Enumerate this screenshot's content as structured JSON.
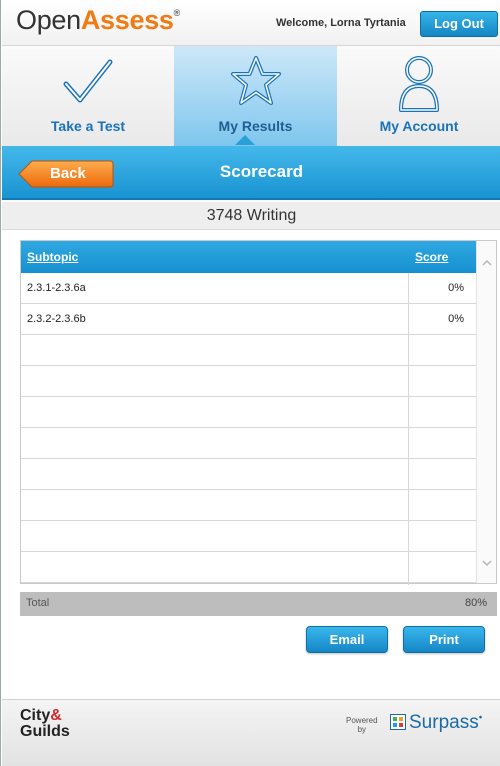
{
  "header": {
    "logo_open": "Open",
    "logo_assess": "Assess",
    "logo_reg": "®",
    "welcome": "Welcome, Lorna Tyrtania",
    "logout_label": "Log Out"
  },
  "nav": {
    "tabs": [
      {
        "label": "Take a Test",
        "icon": "checkmark-icon",
        "active": false
      },
      {
        "label": "My Results",
        "icon": "star-icon",
        "active": true
      },
      {
        "label": "My Account",
        "icon": "person-icon",
        "active": false
      }
    ]
  },
  "titlebar": {
    "back_label": "Back",
    "title": "Scorecard"
  },
  "subtitle": "3748 Writing",
  "table": {
    "headers": [
      "Subtopic",
      "Score"
    ],
    "rows": [
      {
        "subtopic": "2.3.1-2.3.6a",
        "score": "0%"
      },
      {
        "subtopic": "2.3.2-2.3.6b",
        "score": "0%"
      },
      {
        "subtopic": "",
        "score": ""
      },
      {
        "subtopic": "",
        "score": ""
      },
      {
        "subtopic": "",
        "score": ""
      },
      {
        "subtopic": "",
        "score": ""
      },
      {
        "subtopic": "",
        "score": ""
      },
      {
        "subtopic": "",
        "score": ""
      },
      {
        "subtopic": "",
        "score": ""
      },
      {
        "subtopic": "",
        "score": ""
      }
    ]
  },
  "total": {
    "label": "Total",
    "value": "80%"
  },
  "actions": {
    "email_label": "Email",
    "print_label": "Print"
  },
  "footer": {
    "cg_city": "City",
    "cg_amp": "&",
    "cg_guilds": "Guilds",
    "powered_1": "Powered",
    "powered_2": "by",
    "surpass": "Surpass",
    "surpass_mark": "•"
  },
  "colors": {
    "accent_blue": "#1993d2",
    "brand_orange": "#f07a14"
  }
}
